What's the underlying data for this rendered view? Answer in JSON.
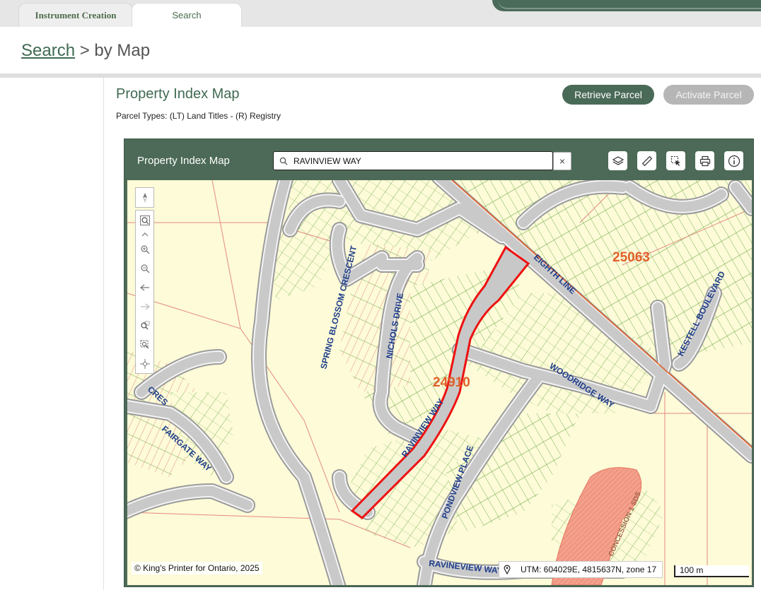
{
  "tabs": [
    {
      "label": "Instrument Creation"
    },
    {
      "label": "Search"
    }
  ],
  "breadcrumb": {
    "link": "Search",
    "separator": ">",
    "current": "by Map"
  },
  "page": {
    "title": "Property Index Map",
    "parcel_types": "Parcel Types: (LT) Land Titles - (R) Registry"
  },
  "buttons": {
    "retrieve": "Retrieve Parcel",
    "activate": "Activate Parcel"
  },
  "map": {
    "title": "Property Index Map",
    "search_value": "RAVINVIEW WAY",
    "clear": "×",
    "tools": [
      "layers-icon",
      "measure-ruler-icon",
      "select-parcel-icon",
      "print-icon",
      "info-icon"
    ],
    "copyright": "© King's Printer for Ontario, 2025",
    "utm": "UTM: 604029E, 4815637N, zone 17",
    "scale": "100 m",
    "labels": {
      "blocks": [
        "25063",
        "24910"
      ],
      "streets": [
        "EIGHTH LINE",
        "KESTELL BOULEVARD",
        "NICHOLS DRIVE",
        "SPRING BLOSSOM CRESCENT",
        "WOODRIDGE WAY",
        "RAVINVIEW WAY",
        "PONDVIEW PLACE",
        "CRES",
        "FAIRGATE WAY",
        "RAVINEVIEW WAY",
        "CONCESSION 1 SDS"
      ]
    }
  },
  "colors": {
    "brand": "#4a6a58",
    "highlight": "#e00000",
    "block_label": "#e0602a",
    "street_label": "#1f3e8a"
  }
}
